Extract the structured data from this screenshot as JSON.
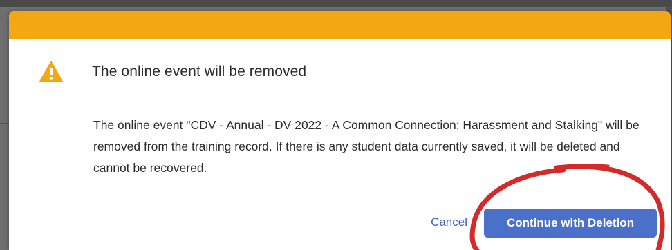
{
  "dialog": {
    "header_color": "#f3a712",
    "icon": "warning-triangle-icon",
    "title": "The online event will be removed",
    "message": "The online event \"CDV - Annual - DV 2022 - A Common Connection: Harassment and Stalking\" will be removed from the training record. If there is any student data currently saved, it will be deleted and cannot be recovered.",
    "cancel_label": "Cancel",
    "confirm_label": "Continue with Deletion"
  },
  "colors": {
    "accent": "#f3a712",
    "primary_button": "#4b70c9",
    "link": "#3f62b5",
    "annotation": "#d42a2a"
  }
}
